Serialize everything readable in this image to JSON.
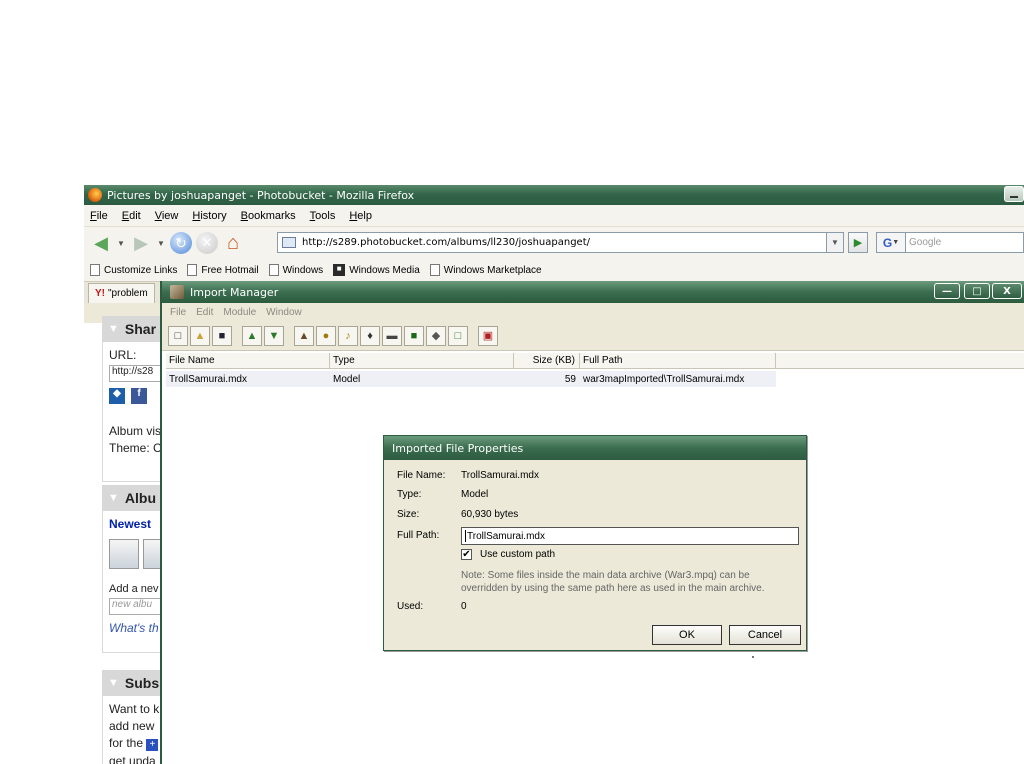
{
  "firefox": {
    "title": "Pictures by joshuapanget - Photobucket - Mozilla Firefox",
    "menu": [
      "File",
      "Edit",
      "View",
      "History",
      "Bookmarks",
      "Tools",
      "Help"
    ],
    "url": "http://s289.photobucket.com/albums/ll230/joshuapanget/",
    "search_placeholder": "Google",
    "search_engine_letter": "G",
    "bookmarks": [
      "Customize Links",
      "Free Hotmail",
      "Windows",
      "Windows Media",
      "Windows Marketplace"
    ],
    "tab_label": "\"problem"
  },
  "page": {
    "share_head": "Shar",
    "url_label": "URL:",
    "url_value": "http://s28",
    "album_visible": "Album vis",
    "theme": "Theme: C",
    "album_head": "Albu",
    "newest": "Newest",
    "add_new": "Add a nev",
    "new_album_placeholder": "new albu",
    "whats_this": "What's th",
    "subs_head": "Subs",
    "subs_lines": [
      "Want to k",
      "add new",
      "for the",
      "get upda"
    ]
  },
  "import_manager": {
    "title": "Import Manager",
    "menu": [
      "File",
      "Edit",
      "Module",
      "Window"
    ],
    "columns": {
      "name": "File Name",
      "type": "Type",
      "size": "Size (KB)",
      "path": "Full Path"
    },
    "rows": [
      {
        "name": "TrollSamurai.mdx",
        "type": "Model",
        "size": "59",
        "path": "war3mapImported\\TrollSamurai.mdx"
      }
    ]
  },
  "dialog": {
    "title": "Imported File Properties",
    "labels": {
      "file_name": "File Name:",
      "type": "Type:",
      "size": "Size:",
      "full_path": "Full Path:",
      "used": "Used:"
    },
    "values": {
      "file_name": "TrollSamurai.mdx",
      "type": "Model",
      "size": "60,930 bytes",
      "full_path": "TrollSamurai.mdx",
      "used": "0"
    },
    "checkbox_label": "Use custom path",
    "checkbox_checked": true,
    "note_line1": "Note: Some files inside the main data archive (War3.mpq) can be",
    "note_line2": "overridden by using the same path here as used in the main archive.",
    "ok_label": "OK",
    "cancel_label": "Cancel"
  }
}
